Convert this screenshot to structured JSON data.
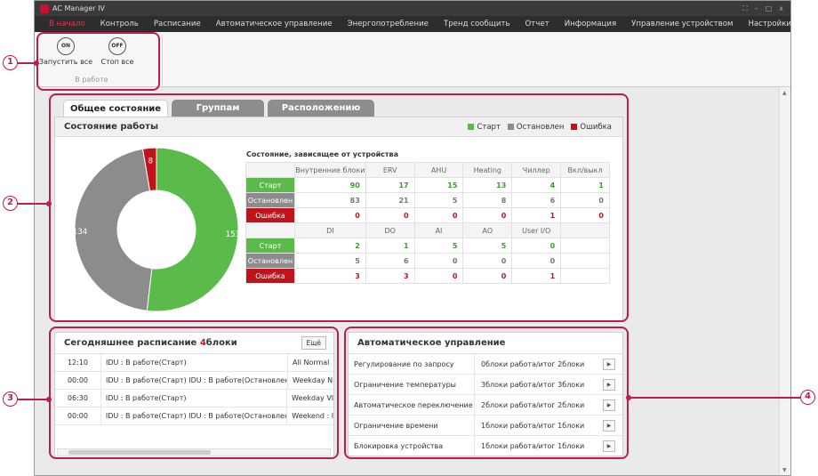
{
  "app": {
    "title": "AC Manager IV",
    "window_controls": [
      "⛶",
      "–",
      "□",
      "x"
    ]
  },
  "menu": [
    "В начало",
    "Контроль",
    "Расписание",
    "Автоматическое управление",
    "Энергопотребление",
    "Тренд сообщить",
    "Отчет",
    "Информация",
    "Управление устройством",
    "Настройки"
  ],
  "ribbon": {
    "on_icon": "ON",
    "on_label": "Запустить все",
    "off_icon": "OFF",
    "off_label": "Стоп все",
    "group_caption": "В работе"
  },
  "tabs": [
    "Общее состояние",
    "Группам",
    "Расположению"
  ],
  "status_panel": {
    "title": "Состояние работы",
    "legend": [
      "Старт",
      "Остановлен",
      "Ошибка"
    ],
    "table_caption": "Состояние, зависящее от устройства",
    "row_labels": [
      "Старт",
      "Остановлен",
      "Ошибка"
    ],
    "headers1": [
      "Внутренние блоки",
      "ERV",
      "AHU",
      "Heating",
      "Чиллер",
      "Вкл/выкл"
    ],
    "rows1": [
      [
        "90",
        "17",
        "15",
        "13",
        "4",
        "1"
      ],
      [
        "83",
        "21",
        "5",
        "8",
        "6",
        "0"
      ],
      [
        "0",
        "0",
        "0",
        "0",
        "1",
        "0"
      ]
    ],
    "headers2": [
      "DI",
      "DO",
      "AI",
      "AO",
      "User I/O",
      ""
    ],
    "rows2": [
      [
        "2",
        "1",
        "5",
        "5",
        "0",
        ""
      ],
      [
        "5",
        "6",
        "0",
        "0",
        "0",
        ""
      ],
      [
        "3",
        "3",
        "0",
        "0",
        "1",
        ""
      ]
    ]
  },
  "colors": {
    "start": "#5bbb4a",
    "stopped": "#8c8c8c",
    "error": "#c0141d",
    "accent": "#c01b4a"
  },
  "chart_data": {
    "type": "pie",
    "categories": [
      "Старт",
      "Остановлен",
      "Ошибка"
    ],
    "values": [
      153,
      134,
      8
    ],
    "labels": [
      "153",
      "134",
      "8"
    ]
  },
  "schedule": {
    "title_prefix": "Сегодняшнее расписание",
    "title_count": "4",
    "title_suffix": "блоки",
    "more_label": "Ещё",
    "rows": [
      {
        "time": "12:10",
        "desc": "IDU : В работе(Старт)",
        "name": "All Normal"
      },
      {
        "time": "00:00",
        "desc": "IDU : В работе(Старт) IDU : В работе(Остановлен)",
        "name": "Weekday N"
      },
      {
        "time": "06:30",
        "desc": "IDU : В работе(Старт)",
        "name": "Weekday VI"
      },
      {
        "time": "00:00",
        "desc": "IDU : В работе(Старт) IDU : В работе(Остановлен)",
        "name": "Weekend : I"
      }
    ]
  },
  "auto_control": {
    "title": "Автоматическое управление",
    "rows": [
      {
        "name": "Регулирование по запросу",
        "status": "0блоки  работа/итог  2блоки"
      },
      {
        "name": "Ограничение температуры",
        "status": "3блоки  работа/итог  3блоки"
      },
      {
        "name": "Автоматическое переключение",
        "status": "2блоки  работа/итог  2блоки"
      },
      {
        "name": "Ограничение времени",
        "status": "1блоки  работа/итог  1блоки"
      },
      {
        "name": "Блокировка устройства",
        "status": "1блоки  работа/итог  1блоки"
      }
    ]
  },
  "callouts": [
    "1",
    "2",
    "3",
    "4"
  ]
}
